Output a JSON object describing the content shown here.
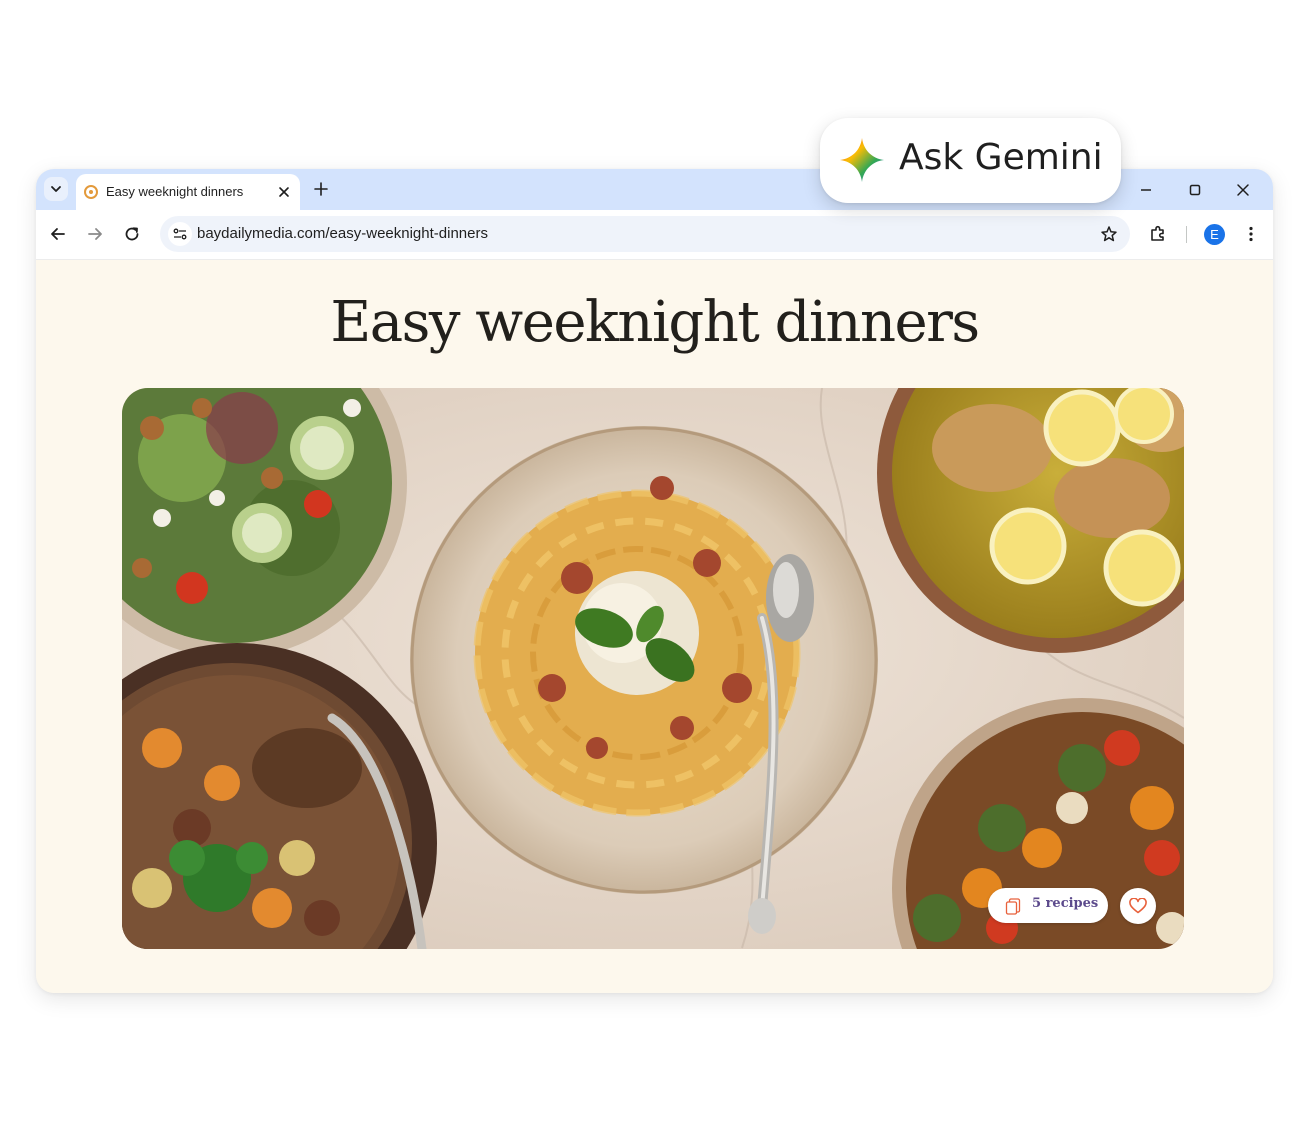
{
  "browser": {
    "tab": {
      "title": "Easy weeknight dinners"
    },
    "address_bar": {
      "url": "baydailymedia.com/easy-weeknight-dinners"
    },
    "profile_initial": "E"
  },
  "page": {
    "title": "Easy weeknight dinners",
    "hero_image": {
      "dishes": [
        "salad",
        "spaghetti bolognese",
        "chicken piccata",
        "beef stew",
        "roasted vegetables"
      ]
    },
    "recipes_chip": {
      "label": "5 recipes"
    }
  },
  "gemini": {
    "label": "Ask Gemini"
  },
  "icons": {
    "tab_search": "chevron-down-icon",
    "favicon": "site-favicon-icon",
    "close": "close-icon",
    "new_tab": "plus-icon",
    "back": "arrow-left-icon",
    "forward": "arrow-right-icon",
    "reload": "reload-icon",
    "site_info": "tune-icon",
    "bookmark": "star-icon",
    "extensions": "puzzle-icon",
    "menu": "more-vert-icon",
    "recipes": "stack-icon",
    "favorite": "heart-icon",
    "gemini": "sparkle-icon"
  },
  "colors": {
    "tab_strip": "#d3e3fd",
    "page_background": "#fdf8ed",
    "recipes_text": "#5c4a8c",
    "heart": "#e8613c"
  }
}
